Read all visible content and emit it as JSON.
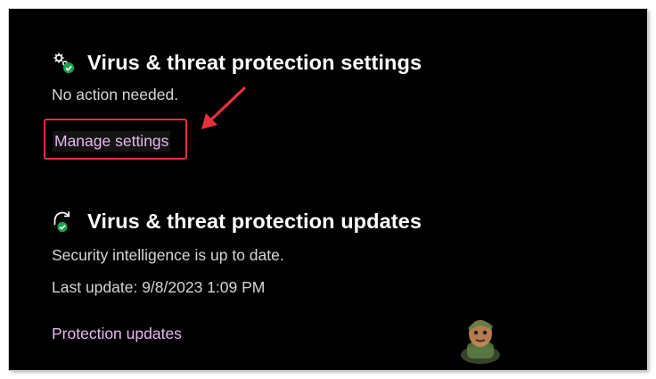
{
  "settings_section": {
    "icon": "gear-shield-check-icon",
    "title": "Virus & threat protection settings",
    "status": "No action needed.",
    "link_label": "Manage settings"
  },
  "updates_section": {
    "icon": "refresh-shield-check-icon",
    "title": "Virus & threat protection updates",
    "status": "Security intelligence is up to date.",
    "last_update": "Last update: 9/8/2023 1:09 PM",
    "link_label": "Protection updates"
  },
  "annotation": {
    "highlight_color": "#e5313e",
    "arrow": "red-arrow-icon"
  },
  "colors": {
    "background": "#000000",
    "text": "#ffffff",
    "secondary_text": "#d6d6d6",
    "link": "#e7b8f0",
    "check_badge": "#16a34a"
  },
  "watermark": {
    "icon": "appuals-mascot-logo"
  }
}
